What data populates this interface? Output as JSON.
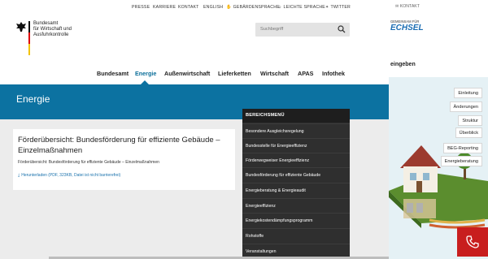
{
  "topbar": {
    "links": [
      "PRESSE",
      "KARRIERE",
      "KONTAKT",
      "ENGLISH",
      "GEBÄRDENSPRACHE",
      "LEICHTE SPRACHE",
      "TWITTER"
    ]
  },
  "header": {
    "org_line1": "Bundesamt",
    "org_line2": "für Wirtschaft und",
    "org_line3": "Ausfuhrkontrolle",
    "search_placeholder": "Suchbegriff"
  },
  "nav": [
    "Bundesamt",
    "Energie",
    "Außenwirtschaft",
    "Lieferketten",
    "Wirtschaft",
    "APAS",
    "Infothek"
  ],
  "nav_active": "Energie",
  "banner": {
    "title": "Energie"
  },
  "card": {
    "title": "Förderübersicht: Bundesförderung für effiziente Gebäude – Einzelmaßnahmen",
    "subtitle": "Förderübersicht: Bundesförderung für effiziente Gebäude – Einzelmaßnahmen",
    "download": "Herunterladen (PDF, 323KB, Datei ist nicht barrierefrei)"
  },
  "menu": {
    "header": "BEREICHSMENÜ",
    "items": [
      "Besondere Ausgleichsregelung",
      "Bundesstelle für Energieeffizienz",
      "Förderwegweiser Energieeffizienz",
      "Bundesförderung für effiziente Gebäude",
      "Energieberatung & Energieaudit",
      "Energieeffizienz",
      "Energiekostendämpfungsprogramm",
      "Rohstoffe",
      "Veranstaltungen"
    ]
  },
  "side": {
    "kontakt": "KONTAKT",
    "logo_small": "GEMEINSAM FÜR",
    "logo_big": "ECHSEL",
    "eingeben": "eingeben",
    "buttons": [
      "Einleitung",
      "Änderungen",
      "Struktur",
      "Überblick",
      "BEG-Reporting",
      "Energieberatung"
    ]
  },
  "colors": {
    "accent": "#0c72a1",
    "menu_bg": "#2f2f2f",
    "phone": "#c81e1e"
  }
}
